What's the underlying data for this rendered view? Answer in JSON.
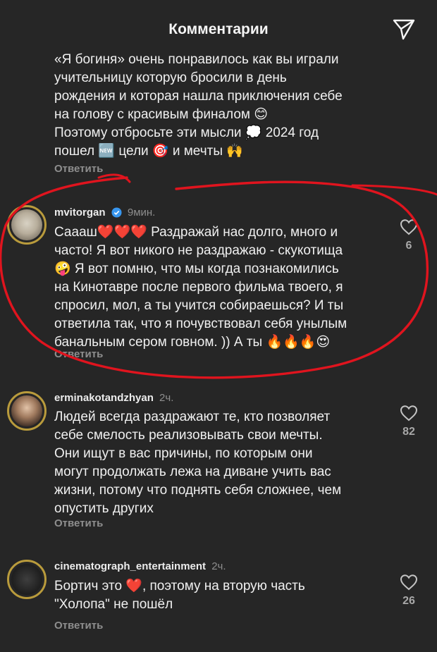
{
  "header": {
    "title": "Комментарии",
    "send_icon": "send-icon"
  },
  "comments": [
    {
      "username": "",
      "time": "",
      "lines": [
        "«Я богиня» очень понравилось как вы играли",
        "учительницу которую бросили в день",
        "рождения и которая нашла приключения себе",
        "на голову с красивым финалом 😊",
        "Поэтому отбросьте эти мысли 💭 2024 год",
        "пошел 🆕 цели 🎯 и мечты 🙌"
      ],
      "reply": "Ответить"
    },
    {
      "username": "mvitorgan",
      "verified": true,
      "time": "9мин.",
      "lines": [
        "Сааaш❤️❤️❤️ Раздражай нас долго, много и",
        "часто! Я вот никого не раздражаю - скукотища",
        "🤪 Я вот помню, что мы когда познакомились",
        "на Кинотавре после первого фильма твоего, я",
        "спросил, мол, а ты учится собираешься? И ты",
        "ответила так, что я почувствовал себя унылым",
        "банальным сером говном. )) А ты 🔥🔥🔥😍"
      ],
      "reply": "Ответить",
      "likes": "6"
    },
    {
      "username": "erminakotandzhyan",
      "time": "2ч.",
      "lines": [
        "Людей всегда раздражают те, кто позволяет",
        "себе смелость реализовывать свои мечты.",
        "Они ищут в вас причины, по которым они",
        "могут продолжать лежа на диване учить вас",
        "жизни, потому что поднять себя сложнее, чем",
        "опустить других"
      ],
      "reply": "Ответить",
      "likes": "82"
    },
    {
      "username": "cinematograph_entertainment",
      "time": "2ч.",
      "lines": [
        "Бортич это ❤️, поэтому на вторую часть",
        "\"Холопа\" не пошёл"
      ],
      "reply": "Ответить",
      "likes": "26"
    }
  ],
  "colors": {
    "background": "#262626",
    "annotation_circle": "#e0141e",
    "story_ring": "#b99b3c",
    "verified": "#3897f0"
  }
}
